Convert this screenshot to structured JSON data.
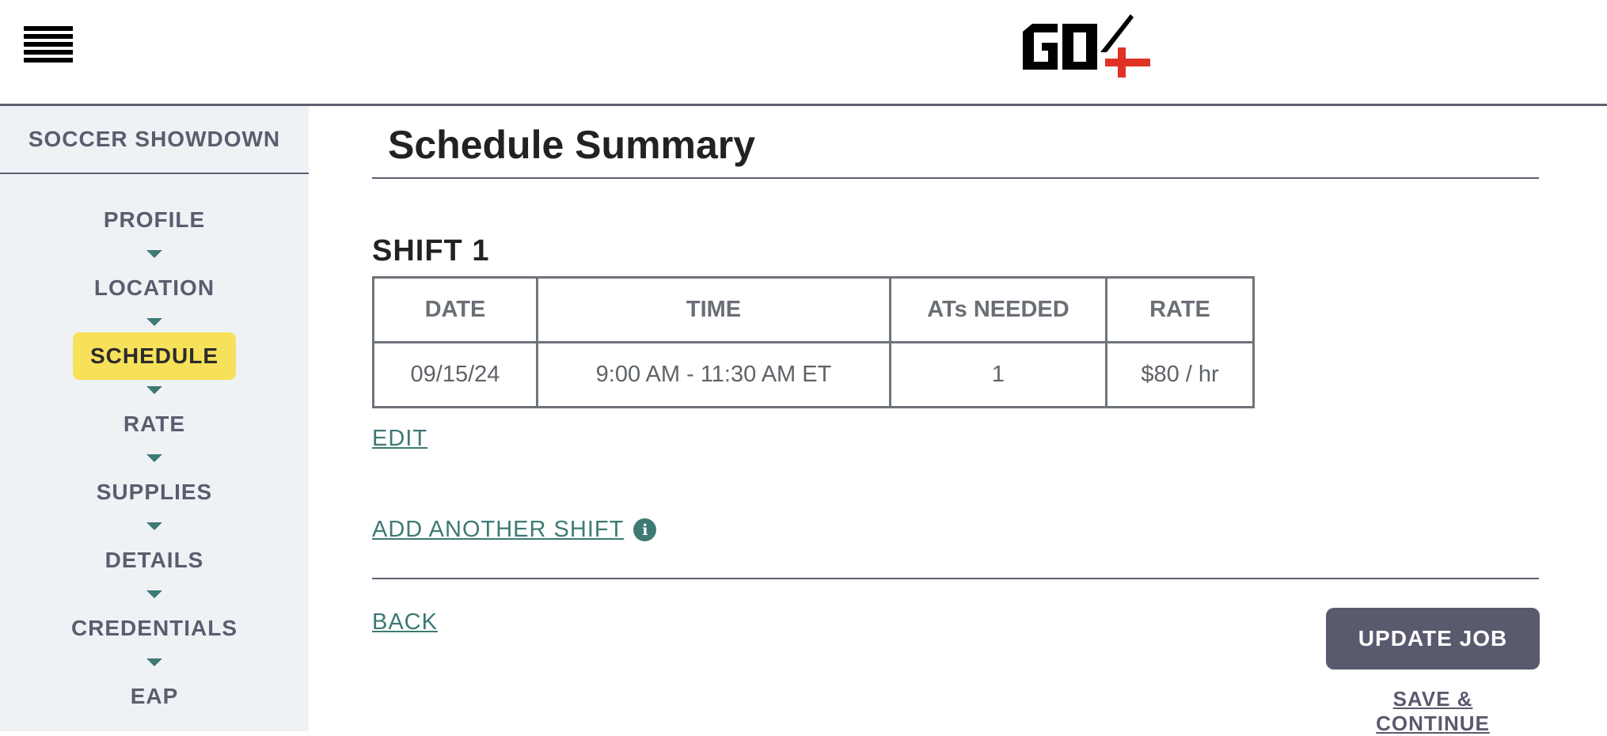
{
  "header": {
    "menu_icon": "hamburger-menu-icon",
    "logo_text": "GO4",
    "logo_colors": {
      "primary": "#000000",
      "cross": "#e03127"
    }
  },
  "sidebar": {
    "title": "SOCCER SHOWDOWN",
    "items": [
      {
        "label": "PROFILE",
        "active": false
      },
      {
        "label": "LOCATION",
        "active": false
      },
      {
        "label": "SCHEDULE",
        "active": true
      },
      {
        "label": "RATE",
        "active": false
      },
      {
        "label": "SUPPLIES",
        "active": false
      },
      {
        "label": "DETAILS",
        "active": false
      },
      {
        "label": "CREDENTIALS",
        "active": false
      },
      {
        "label": "EAP",
        "active": false
      }
    ],
    "arrow_icon": "chevron-down-icon",
    "active_color": "#f7e05a"
  },
  "main": {
    "title": "Schedule Summary",
    "shift": {
      "title": "SHIFT 1",
      "headers": {
        "date": "DATE",
        "time": "TIME",
        "ats": "ATs NEEDED",
        "rate": "RATE"
      },
      "row": {
        "date": "09/15/24",
        "time": "9:00 AM - 11:30 AM ET",
        "ats": "1",
        "rate": "$80 / hr"
      },
      "edit_label": "EDIT"
    },
    "add_shift_label": "ADD ANOTHER SHIFT",
    "add_shift_info_icon": "info-icon",
    "back_label": "BACK",
    "update_button_label": "UPDATE JOB",
    "save_continue_label": "SAVE & CONTINUE",
    "accent_color": "#3d7a74"
  }
}
